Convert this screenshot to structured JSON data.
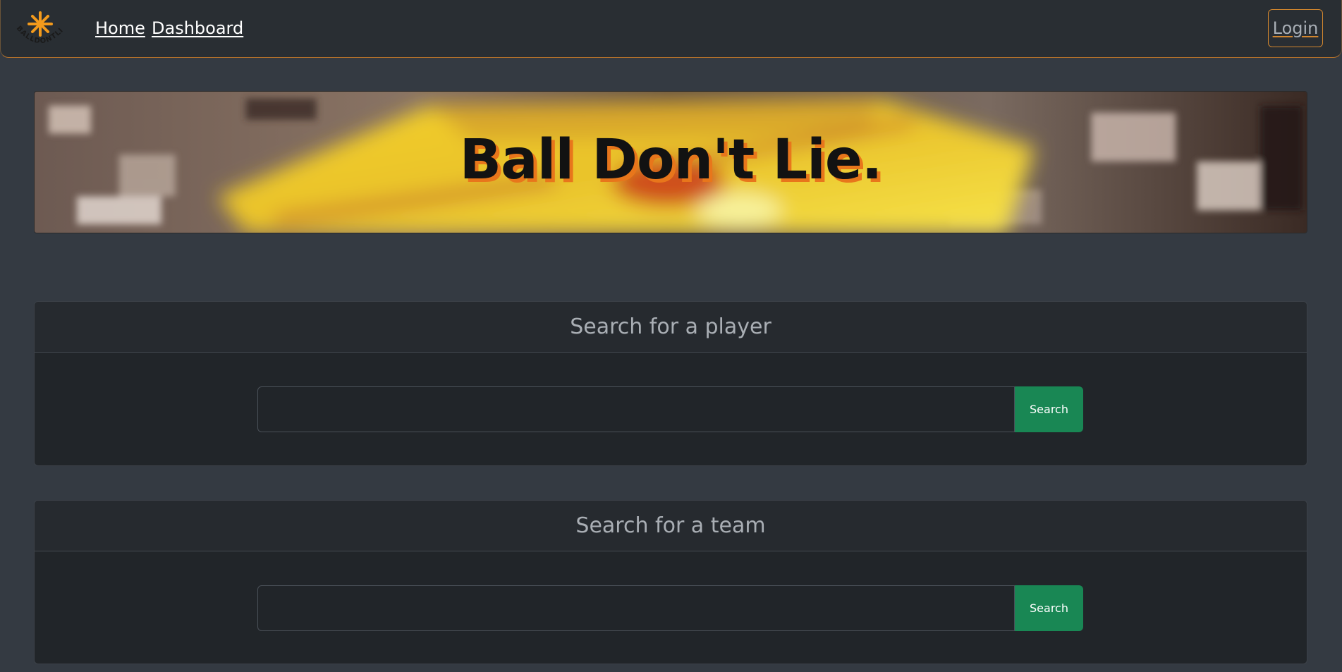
{
  "nav": {
    "logo_text": "BALLDONTLIE",
    "links": [
      {
        "label": "Home"
      },
      {
        "label": "Dashboard"
      }
    ],
    "login_label": "Login"
  },
  "hero": {
    "title": "Ball Don't Lie."
  },
  "player_search": {
    "title": "Search for a player",
    "input_value": "",
    "button_label": "Search"
  },
  "team_search": {
    "title": "Search for a team",
    "input_value": "",
    "button_label": "Search"
  },
  "colors": {
    "page_bg": "#343a42",
    "nav_bg": "#292e33",
    "accent_orange": "#d2862e",
    "card_bg": "#212529",
    "search_button": "#198754"
  }
}
